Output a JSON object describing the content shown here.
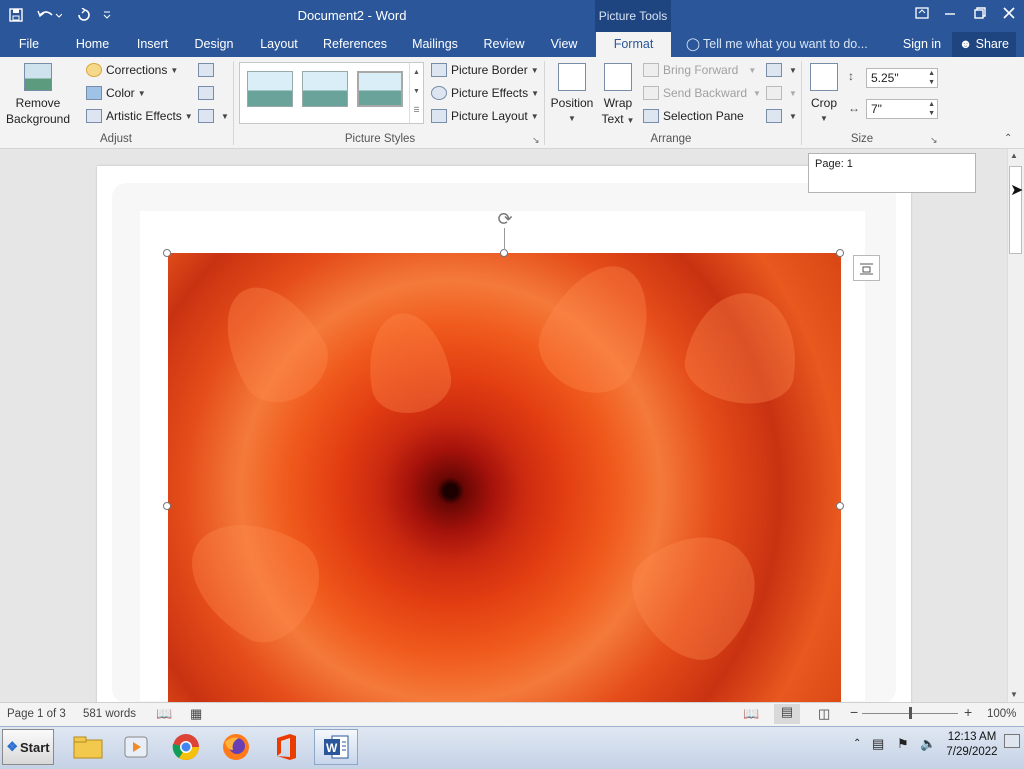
{
  "window": {
    "title": "Document2 - Word",
    "context_tab_group": "Picture Tools",
    "controls": [
      "minimize",
      "restore",
      "close"
    ]
  },
  "quick_access": {
    "icons": [
      "save-icon",
      "undo-icon",
      "redo-icon",
      "customize-icon"
    ]
  },
  "tabs": [
    {
      "label": "File",
      "active": false
    },
    {
      "label": "Home",
      "active": false
    },
    {
      "label": "Insert",
      "active": false
    },
    {
      "label": "Design",
      "active": false
    },
    {
      "label": "Layout",
      "active": false
    },
    {
      "label": "References",
      "active": false
    },
    {
      "label": "Mailings",
      "active": false
    },
    {
      "label": "Review",
      "active": false
    },
    {
      "label": "View",
      "active": false
    },
    {
      "label": "Format",
      "active": true
    }
  ],
  "tell_me": "Tell me what you want to do...",
  "sign_in": "Sign in",
  "share": "Share",
  "ribbon": {
    "adjust": {
      "remove_bg_line1": "Remove",
      "remove_bg_line2": "Background",
      "corrections": "Corrections",
      "color": "Color",
      "artistic_effects": "Artistic Effects",
      "label": "Adjust"
    },
    "picture_styles": {
      "picture_border": "Picture Border",
      "picture_effects": "Picture Effects",
      "picture_layout": "Picture Layout",
      "label": "Picture Styles"
    },
    "arrange": {
      "position": "Position",
      "wrap_line1": "Wrap",
      "wrap_line2": "Text",
      "bring_forward": "Bring Forward",
      "send_backward": "Send Backward",
      "selection_pane": "Selection Pane",
      "label": "Arrange"
    },
    "size": {
      "crop": "Crop",
      "height": "5.25\"",
      "width": "7\"",
      "label": "Size"
    }
  },
  "document": {
    "tooltip": "Page: 1"
  },
  "status": {
    "page": "Page 1 of 3",
    "words": "581 words",
    "zoom": "100%",
    "zoom_level": 1.0
  },
  "taskbar": {
    "start": "Start",
    "apps": [
      "file-explorer-icon",
      "media-player-icon",
      "chrome-icon",
      "firefox-icon",
      "office-icon",
      "word-icon"
    ],
    "time": "12:13 AM",
    "date": "7/29/2022"
  }
}
